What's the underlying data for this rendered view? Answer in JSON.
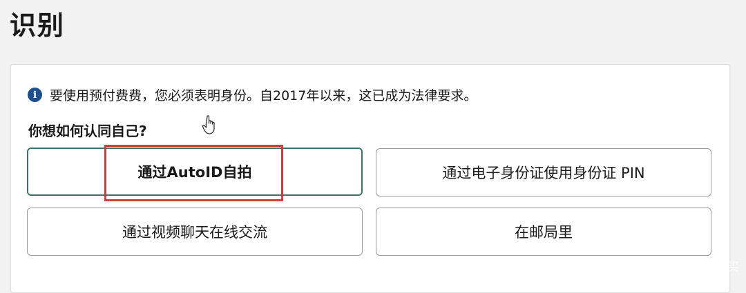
{
  "page": {
    "title": "识别"
  },
  "notice": {
    "icon": "info-icon",
    "text": "要使用预付费费，您必须表明身份。自2017年以来，这已成为法律要求。"
  },
  "question": {
    "text": "你想如何认同自己?"
  },
  "options": [
    {
      "label": "通过AutoID自拍",
      "selected": true
    },
    {
      "label": "通过电子身份证使用身份证 PIN",
      "selected": false
    },
    {
      "label": "通过视频聊天在线交流",
      "selected": false
    },
    {
      "label": "在邮局里",
      "selected": false
    }
  ],
  "colors": {
    "selected_border": "#3c7368",
    "highlight": "#d23b3b",
    "info_icon": "#1f4e8c"
  },
  "watermark": {
    "text": "什么值得买"
  }
}
